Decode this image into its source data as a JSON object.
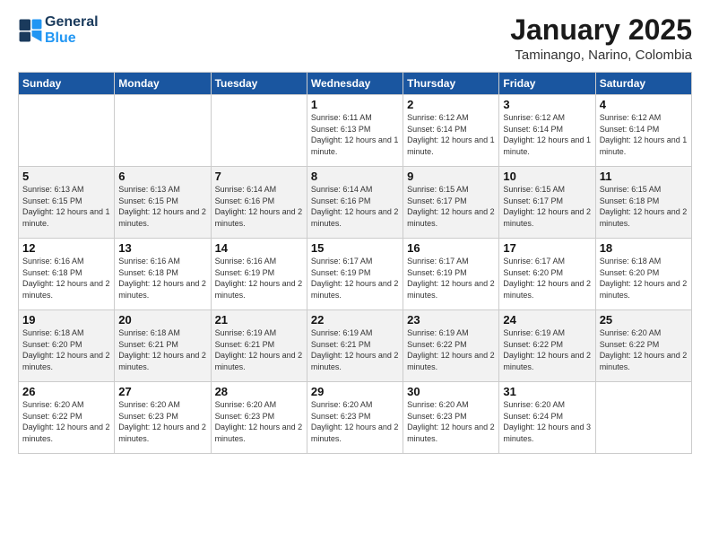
{
  "header": {
    "logo_line1": "General",
    "logo_line2": "Blue",
    "month_title": "January 2025",
    "subtitle": "Taminango, Narino, Colombia"
  },
  "days_of_week": [
    "Sunday",
    "Monday",
    "Tuesday",
    "Wednesday",
    "Thursday",
    "Friday",
    "Saturday"
  ],
  "weeks": [
    [
      {
        "day": "",
        "text": ""
      },
      {
        "day": "",
        "text": ""
      },
      {
        "day": "",
        "text": ""
      },
      {
        "day": "1",
        "text": "Sunrise: 6:11 AM\nSunset: 6:13 PM\nDaylight: 12 hours and 1 minute."
      },
      {
        "day": "2",
        "text": "Sunrise: 6:12 AM\nSunset: 6:14 PM\nDaylight: 12 hours and 1 minute."
      },
      {
        "day": "3",
        "text": "Sunrise: 6:12 AM\nSunset: 6:14 PM\nDaylight: 12 hours and 1 minute."
      },
      {
        "day": "4",
        "text": "Sunrise: 6:12 AM\nSunset: 6:14 PM\nDaylight: 12 hours and 1 minute."
      }
    ],
    [
      {
        "day": "5",
        "text": "Sunrise: 6:13 AM\nSunset: 6:15 PM\nDaylight: 12 hours and 1 minute."
      },
      {
        "day": "6",
        "text": "Sunrise: 6:13 AM\nSunset: 6:15 PM\nDaylight: 12 hours and 2 minutes."
      },
      {
        "day": "7",
        "text": "Sunrise: 6:14 AM\nSunset: 6:16 PM\nDaylight: 12 hours and 2 minutes."
      },
      {
        "day": "8",
        "text": "Sunrise: 6:14 AM\nSunset: 6:16 PM\nDaylight: 12 hours and 2 minutes."
      },
      {
        "day": "9",
        "text": "Sunrise: 6:15 AM\nSunset: 6:17 PM\nDaylight: 12 hours and 2 minutes."
      },
      {
        "day": "10",
        "text": "Sunrise: 6:15 AM\nSunset: 6:17 PM\nDaylight: 12 hours and 2 minutes."
      },
      {
        "day": "11",
        "text": "Sunrise: 6:15 AM\nSunset: 6:18 PM\nDaylight: 12 hours and 2 minutes."
      }
    ],
    [
      {
        "day": "12",
        "text": "Sunrise: 6:16 AM\nSunset: 6:18 PM\nDaylight: 12 hours and 2 minutes."
      },
      {
        "day": "13",
        "text": "Sunrise: 6:16 AM\nSunset: 6:18 PM\nDaylight: 12 hours and 2 minutes."
      },
      {
        "day": "14",
        "text": "Sunrise: 6:16 AM\nSunset: 6:19 PM\nDaylight: 12 hours and 2 minutes."
      },
      {
        "day": "15",
        "text": "Sunrise: 6:17 AM\nSunset: 6:19 PM\nDaylight: 12 hours and 2 minutes."
      },
      {
        "day": "16",
        "text": "Sunrise: 6:17 AM\nSunset: 6:19 PM\nDaylight: 12 hours and 2 minutes."
      },
      {
        "day": "17",
        "text": "Sunrise: 6:17 AM\nSunset: 6:20 PM\nDaylight: 12 hours and 2 minutes."
      },
      {
        "day": "18",
        "text": "Sunrise: 6:18 AM\nSunset: 6:20 PM\nDaylight: 12 hours and 2 minutes."
      }
    ],
    [
      {
        "day": "19",
        "text": "Sunrise: 6:18 AM\nSunset: 6:20 PM\nDaylight: 12 hours and 2 minutes."
      },
      {
        "day": "20",
        "text": "Sunrise: 6:18 AM\nSunset: 6:21 PM\nDaylight: 12 hours and 2 minutes."
      },
      {
        "day": "21",
        "text": "Sunrise: 6:19 AM\nSunset: 6:21 PM\nDaylight: 12 hours and 2 minutes."
      },
      {
        "day": "22",
        "text": "Sunrise: 6:19 AM\nSunset: 6:21 PM\nDaylight: 12 hours and 2 minutes."
      },
      {
        "day": "23",
        "text": "Sunrise: 6:19 AM\nSunset: 6:22 PM\nDaylight: 12 hours and 2 minutes."
      },
      {
        "day": "24",
        "text": "Sunrise: 6:19 AM\nSunset: 6:22 PM\nDaylight: 12 hours and 2 minutes."
      },
      {
        "day": "25",
        "text": "Sunrise: 6:20 AM\nSunset: 6:22 PM\nDaylight: 12 hours and 2 minutes."
      }
    ],
    [
      {
        "day": "26",
        "text": "Sunrise: 6:20 AM\nSunset: 6:22 PM\nDaylight: 12 hours and 2 minutes."
      },
      {
        "day": "27",
        "text": "Sunrise: 6:20 AM\nSunset: 6:23 PM\nDaylight: 12 hours and 2 minutes."
      },
      {
        "day": "28",
        "text": "Sunrise: 6:20 AM\nSunset: 6:23 PM\nDaylight: 12 hours and 2 minutes."
      },
      {
        "day": "29",
        "text": "Sunrise: 6:20 AM\nSunset: 6:23 PM\nDaylight: 12 hours and 2 minutes."
      },
      {
        "day": "30",
        "text": "Sunrise: 6:20 AM\nSunset: 6:23 PM\nDaylight: 12 hours and 2 minutes."
      },
      {
        "day": "31",
        "text": "Sunrise: 6:20 AM\nSunset: 6:24 PM\nDaylight: 12 hours and 3 minutes."
      },
      {
        "day": "",
        "text": ""
      }
    ]
  ]
}
